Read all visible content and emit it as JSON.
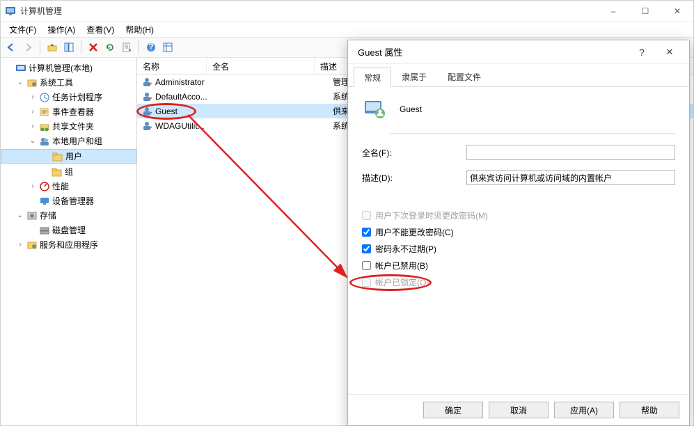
{
  "window": {
    "title": "计算机管理",
    "min_icon": "–",
    "max_icon": "☐",
    "close_icon": "✕"
  },
  "menu": {
    "file": "文件(F)",
    "action": "操作(A)",
    "view": "查看(V)",
    "help": "帮助(H)"
  },
  "tree": {
    "root": "计算机管理(本地)",
    "systools": "系统工具",
    "task": "任务计划程序",
    "event": "事件查看器",
    "share": "共享文件夹",
    "lug": "本地用户和组",
    "users": "用户",
    "groups": "组",
    "perf": "性能",
    "devmgr": "设备管理器",
    "storage": "存储",
    "diskmgr": "磁盘管理",
    "services": "服务和应用程序"
  },
  "cols": {
    "name": "名称",
    "full": "全名",
    "desc": "描述"
  },
  "users": [
    {
      "name": "Administrator",
      "full": "",
      "desc": "管理计"
    },
    {
      "name": "DefaultAcco...",
      "full": "",
      "desc": "系统管"
    },
    {
      "name": "Guest",
      "full": "",
      "desc": "供来宾"
    },
    {
      "name": "WDAGUtilit...",
      "full": "",
      "desc": "系统为"
    }
  ],
  "dialog": {
    "title": "Guest 属性",
    "help": "?",
    "close": "✕",
    "tabs": {
      "general": "常规",
      "member": "隶属于",
      "profile": "配置文件"
    },
    "account_name": "Guest",
    "fullname_lbl": "全名(F):",
    "fullname_val": "",
    "desc_lbl": "描述(D):",
    "desc_val": "供来宾访问计算机或访问域的内置帐户",
    "chk_changepw": "用户下次登录时须更改密码(M)",
    "chk_cantchange": "用户不能更改密码(C)",
    "chk_noexpiry": "密码永不过期(P)",
    "chk_disabled": "帐户已禁用(B)",
    "chk_locked": "帐户已锁定(O)",
    "btn_ok": "确定",
    "btn_cancel": "取消",
    "btn_apply": "应用(A)",
    "btn_help": "帮助"
  }
}
